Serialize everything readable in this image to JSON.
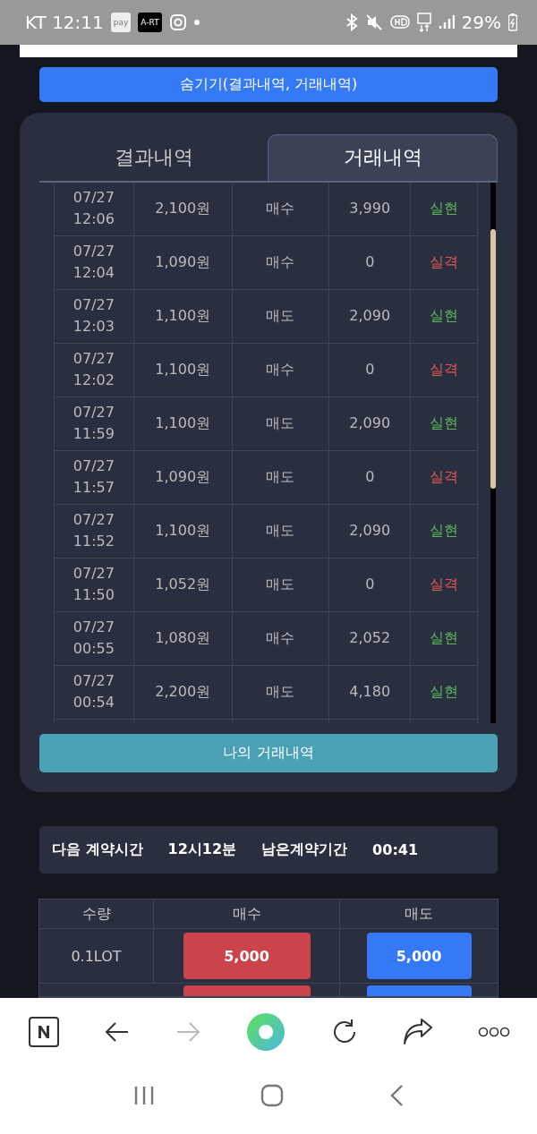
{
  "status_bar": {
    "carrier_time": "KT 12:11",
    "app_badges": [
      "pay",
      "A-RT"
    ],
    "battery": "29%"
  },
  "hide_button": "숨기기(결과내역, 거래내역)",
  "tabs": [
    {
      "label": "결과내역",
      "selected": false
    },
    {
      "label": "거래내역",
      "selected": true
    }
  ],
  "trades": [
    {
      "date": "07/27",
      "time": "12:06",
      "amount": "2,100원",
      "side": "매수",
      "payout": "3,990",
      "result": "실현",
      "win": true
    },
    {
      "date": "07/27",
      "time": "12:04",
      "amount": "1,090원",
      "side": "매수",
      "payout": "0",
      "result": "실격",
      "win": false
    },
    {
      "date": "07/27",
      "time": "12:03",
      "amount": "1,100원",
      "side": "매도",
      "payout": "2,090",
      "result": "실현",
      "win": true
    },
    {
      "date": "07/27",
      "time": "12:02",
      "amount": "1,100원",
      "side": "매수",
      "payout": "0",
      "result": "실격",
      "win": false
    },
    {
      "date": "07/27",
      "time": "11:59",
      "amount": "1,100원",
      "side": "매도",
      "payout": "2,090",
      "result": "실현",
      "win": true
    },
    {
      "date": "07/27",
      "time": "11:57",
      "amount": "1,090원",
      "side": "매도",
      "payout": "0",
      "result": "실격",
      "win": false
    },
    {
      "date": "07/27",
      "time": "11:52",
      "amount": "1,100원",
      "side": "매도",
      "payout": "2,090",
      "result": "실현",
      "win": true
    },
    {
      "date": "07/27",
      "time": "11:50",
      "amount": "1,052원",
      "side": "매도",
      "payout": "0",
      "result": "실격",
      "win": false
    },
    {
      "date": "07/27",
      "time": "00:55",
      "amount": "1,080원",
      "side": "매수",
      "payout": "2,052",
      "result": "실현",
      "win": true
    },
    {
      "date": "07/27",
      "time": "00:54",
      "amount": "2,200원",
      "side": "매도",
      "payout": "4,180",
      "result": "실현",
      "win": true
    }
  ],
  "my_trades_button": "나의 거래내역",
  "contract": {
    "next_label": "다음 계약시간",
    "next_value": "12시12분",
    "remain_label": "남은계약기간",
    "remain_value": "00:41"
  },
  "order_table": {
    "columns": [
      "수량",
      "매수",
      "매도"
    ],
    "rows": [
      {
        "qty": "0.1LOT",
        "buy": "5,000",
        "sell": "5,000"
      }
    ]
  }
}
